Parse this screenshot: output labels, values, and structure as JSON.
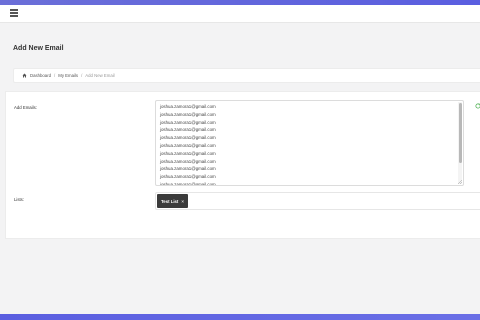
{
  "header": {
    "menu_icon": "hamburger-menu-icon"
  },
  "page": {
    "title": "Add New Email"
  },
  "breadcrumb": {
    "home_icon": "home-icon",
    "items": [
      {
        "label": "Dashboard"
      },
      {
        "label": "My Emails"
      },
      {
        "label": "Add New Email"
      }
    ],
    "separator": "/"
  },
  "form": {
    "emails_label": "Add Emails:",
    "emails": [
      "joshua.zamora1@gmail.com",
      "joshua.zamora1@gmail.com",
      "joshua.zamora1@gmail.com",
      "joshua.zamora1@gmail.com",
      "joshua.zamora1@gmail.com",
      "joshua.zamora1@gmail.com",
      "joshua.zamora1@gmail.com",
      "joshua.zamora1@gmail.com",
      "joshua.zamora1@gmail.com",
      "joshua.zamora1@gmail.com",
      "joshua.zamora1@gmail.com"
    ],
    "status_icon": "refresh-icon",
    "lists_label": "Lists:",
    "selected_lists": [
      {
        "label": "Test List",
        "remove": "×"
      }
    ]
  },
  "colors": {
    "accent": "#5f63dd",
    "tag_bg": "#3a3a3a",
    "status_green": "#4caf50"
  }
}
